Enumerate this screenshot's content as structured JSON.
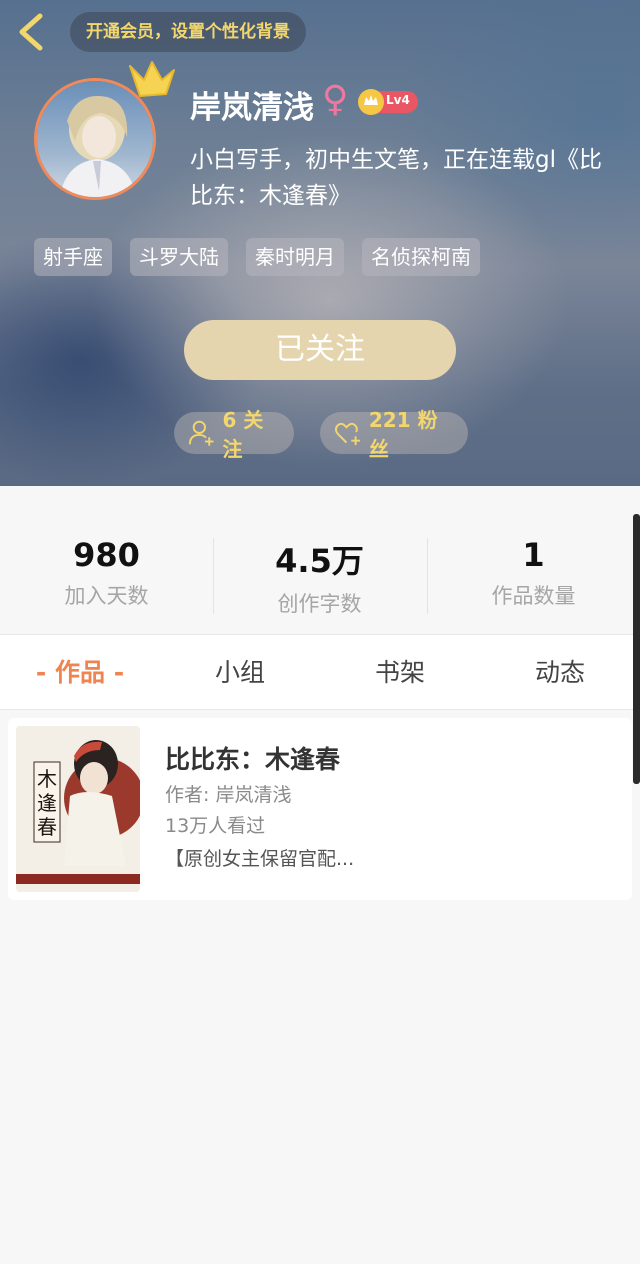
{
  "header": {
    "vip_prompt": "开通会员，设置个性化背景",
    "username": "岸岚清浅",
    "gender_symbol": "♀",
    "level": "Lv4",
    "bio": "小白写手，初中生文笔，正在连载gl《比比东：木逢春》",
    "tags": [
      "射手座",
      "斗罗大陆",
      "秦时明月",
      "名侦探柯南"
    ],
    "follow_button": "已关注",
    "following": "6 关注",
    "fans": "221 粉丝"
  },
  "stats": [
    {
      "value": "980",
      "label": "加入天数"
    },
    {
      "value": "4.5万",
      "label": "创作字数"
    },
    {
      "value": "1",
      "label": "作品数量"
    }
  ],
  "tabs": [
    {
      "label": "- 作品 -",
      "active": true
    },
    {
      "label": "小组",
      "active": false
    },
    {
      "label": "书架",
      "active": false
    },
    {
      "label": "动态",
      "active": false
    }
  ],
  "works": [
    {
      "title": "比比东：木逢春",
      "author": "作者: 岸岚清浅",
      "views": "13万人看过",
      "desc": "【原创女主保留官配...",
      "cover_text": "木逢春"
    }
  ],
  "colors": {
    "accent": "#f0844e",
    "gold": "#f3d66c",
    "follow_button": "#e5d5ae"
  }
}
